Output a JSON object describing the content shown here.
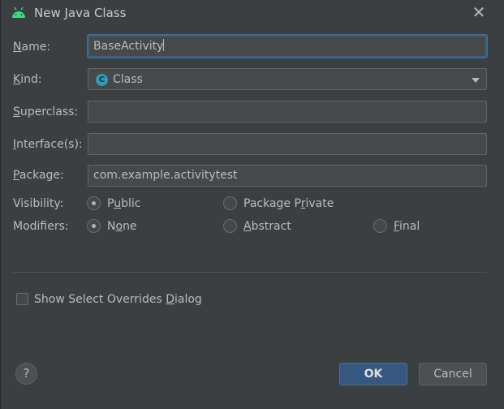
{
  "window": {
    "title": "New Java Class",
    "close_glyph": "✕"
  },
  "form": {
    "name_label": "Name:",
    "name_value": "BaseActivity",
    "kind_label": "Kind:",
    "kind_value": "Class",
    "kind_icon_letter": "C",
    "superclass_label": "Superclass:",
    "superclass_value": "",
    "interfaces_label": "Interface(s):",
    "interfaces_value": "",
    "package_label": "Package:",
    "package_value": "com.example.activitytest",
    "visibility_label": "Visibility:",
    "visibility_options": [
      {
        "label": "Public",
        "selected": true
      },
      {
        "label": "Package Private",
        "selected": false
      }
    ],
    "modifiers_label": "Modifiers:",
    "modifier_options": [
      {
        "label": "None",
        "selected": true
      },
      {
        "label": "Abstract",
        "selected": false
      },
      {
        "label": "Final",
        "selected": false
      }
    ],
    "show_overrides_label": "Show Select Overrides Dialog",
    "show_overrides_checked": false
  },
  "footer": {
    "help_glyph": "?",
    "ok_label": "OK",
    "cancel_label": "Cancel"
  },
  "colors": {
    "background": "#3c3f41",
    "accent": "#365880",
    "android_green": "#3ddc84",
    "class_icon": "#2f9dba"
  }
}
